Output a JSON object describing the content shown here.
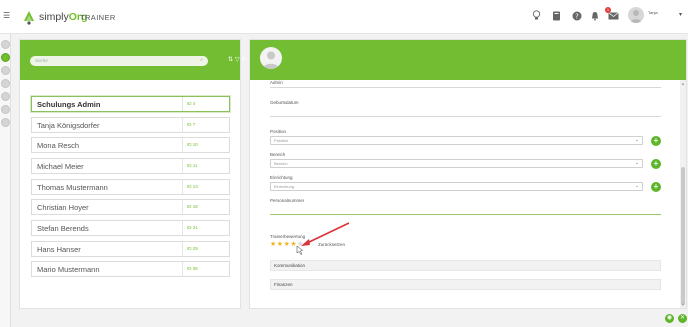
{
  "app": {
    "logo_prefix": "simply",
    "logo_suffix": "Org",
    "title": "TRAINER"
  },
  "header": {
    "icons": [
      "lightbulb-icon",
      "book-icon",
      "help-icon",
      "bell-icon",
      "mail-icon"
    ],
    "notification_count": "1",
    "user_name": "Tanja"
  },
  "sidebar": {
    "search_placeholder": "Suche",
    "people": [
      {
        "name": "Schulungs Admin",
        "id": "ID 4",
        "selected": true
      },
      {
        "name": "Tanja Königsdorfer",
        "id": "ID 7",
        "selected": false
      },
      {
        "name": "Mona Resch",
        "id": "ID 10",
        "selected": false
      },
      {
        "name": "Michael Meier",
        "id": "ID 11",
        "selected": false
      },
      {
        "name": "Thomas Mustermann",
        "id": "ID 13",
        "selected": false
      },
      {
        "name": "Christian Hoyer",
        "id": "ID 18",
        "selected": false
      },
      {
        "name": "Stefan Berends",
        "id": "ID 21",
        "selected": false
      },
      {
        "name": "Hans Hanser",
        "id": "ID 29",
        "selected": false
      },
      {
        "name": "Mario Mustermann",
        "id": "ID 35",
        "selected": false
      }
    ]
  },
  "form": {
    "admin_label": "Admin",
    "birthday_label": "Geburtsdatum",
    "position_label": "Position",
    "position_value": "Position",
    "bereich_label": "Bereich",
    "bereich_value": "Bereich",
    "einrichtung_label": "Einrichtung",
    "einrichtung_value": "Einrichtung",
    "personalnummer_label": "Personalnummer",
    "rating_label": "Trainerbewertung",
    "rating_value": 4,
    "rating_max": 5,
    "reset_label": "Zurücksetzen",
    "sections": [
      "Kommunikation",
      "Finanzen"
    ]
  },
  "colors": {
    "accent": "#72bd32",
    "button": "#5db52a",
    "star": "#f0b429",
    "arrow": "#d9343a"
  }
}
